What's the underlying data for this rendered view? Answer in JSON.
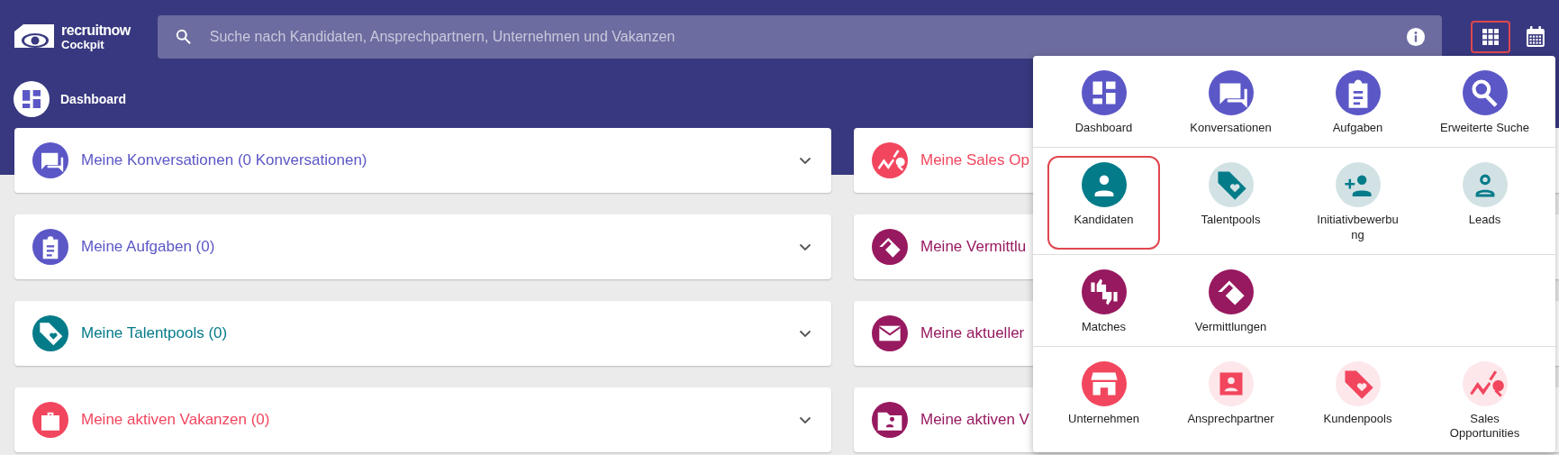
{
  "logo": {
    "brand": "recruitnow",
    "product": "Cockpit"
  },
  "search": {
    "placeholder": "Suche nach Kandidaten, Ansprechpartnern, Unternehmen und Vakanzen"
  },
  "apps_button": {
    "selected": true
  },
  "page": {
    "title": "Dashboard"
  },
  "left_cards": [
    {
      "title": "Meine Konversationen (0 Konversationen)",
      "color": "#5b57c6"
    },
    {
      "title": "Meine Aufgaben (0)",
      "color": "#5b57c6"
    },
    {
      "title": "Meine Talentpools (0)",
      "color": "#047b89"
    },
    {
      "title": "Meine aktiven Vakanzen (0)",
      "color": "#f2465e"
    }
  ],
  "right_cards": [
    {
      "title": "Meine Sales Op",
      "color": "#f2465e"
    },
    {
      "title": "Meine Vermittlu",
      "color": "#97195f"
    },
    {
      "title": "Meine aktueller",
      "color": "#97195f"
    },
    {
      "title": "Meine aktiven V",
      "color": "#97195f"
    }
  ],
  "menu": {
    "sections": [
      {
        "color": "#5b57c6",
        "items": [
          {
            "label": "Dashboard",
            "filled": true,
            "selected": false
          },
          {
            "label": "Konversationen",
            "filled": true,
            "selected": false
          },
          {
            "label": "Aufgaben",
            "filled": true,
            "selected": false
          },
          {
            "label": "Erweiterte Suche",
            "filled": true,
            "selected": false
          }
        ]
      },
      {
        "color": "#047b89",
        "items": [
          {
            "label": "Kandidaten",
            "filled": true,
            "selected": true
          },
          {
            "label": "Talentpools",
            "filled": false,
            "selected": false
          },
          {
            "label": "Initiativbewerbu\nng",
            "filled": false,
            "selected": false
          },
          {
            "label": "Leads",
            "filled": false,
            "selected": false
          }
        ]
      },
      {
        "color": "#97195f",
        "items": [
          {
            "label": "Matches",
            "filled": true,
            "selected": false
          },
          {
            "label": "Vermittlungen",
            "filled": true,
            "selected": false
          }
        ]
      },
      {
        "color": "#f2465e",
        "items": [
          {
            "label": "Unternehmen",
            "filled": true,
            "selected": false
          },
          {
            "label": "Ansprechpartner",
            "filled": false,
            "selected": false
          },
          {
            "label": "Kundenpools",
            "filled": false,
            "selected": false
          },
          {
            "label": "Sales Opportunities",
            "filled": false,
            "selected": false
          }
        ]
      }
    ]
  }
}
